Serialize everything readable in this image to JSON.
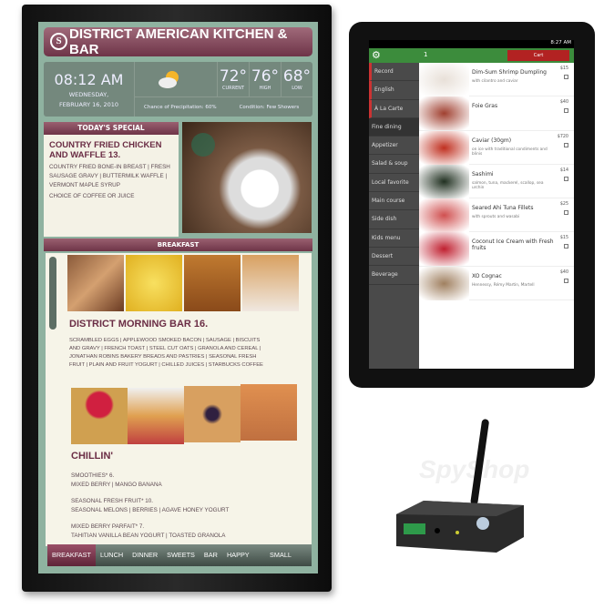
{
  "signage": {
    "title": "DISTRICT AMERICAN KITCHEN & BAR",
    "logo_letter": "S",
    "time": "08:12 AM",
    "day": "WEDNESDAY,",
    "date": "FEBRUARY 16, 2010",
    "weather_icon": "partly-cloudy-icon",
    "temps": [
      {
        "value": "72°",
        "label": "CURRENT"
      },
      {
        "value": "76°",
        "label": "HIGH"
      },
      {
        "value": "68°",
        "label": "LOW"
      }
    ],
    "precipitation": "Chance of Precipitation: 60%",
    "condition": "Condition: Few Showers",
    "special": {
      "header": "TODAY'S SPECIAL",
      "title": "COUNTRY FRIED CHICKEN AND WAFFLE 13.",
      "desc": "COUNTRY FRIED BONE-IN BREAST | FRESH SAUSAGE GRAVY | BUTTERMILK WAFFLE | VERMONT MAPLE SYRUP",
      "extra": "CHOICE OF COFFEE OR JUICE"
    },
    "section": "BREAKFAST",
    "morning": {
      "title": "DISTRICT MORNING BAR 16.",
      "desc": "SCRAMBLED EGGS | APPLEWOOD SMOKED BACON | SAUSAGE | BISCUITS AND GRAVY | FRENCH TOAST | STEEL CUT OATS | GRANOLA AND CEREAL | JONATHAN ROBINS BAKERY BREADS AND PASTRIES | SEASONAL FRESH FRUIT | PLAIN AND FRUIT YOGURT | CHILLED JUICES | STARBUCKS COFFEE"
    },
    "chillin": {
      "title": "CHILLIN'",
      "items": [
        {
          "name": "SMOOTHIES* 6.",
          "desc": "MIXED BERRY | MANGO BANANA"
        },
        {
          "name": "SEASONAL FRESH FRUIT* 10.",
          "desc": "SEASONAL MELONS | BERRIES | AGAVE HONEY YOGURT"
        },
        {
          "name": "MIXED BERRY PARFAIT* 7.",
          "desc": "TAHITIAN VANILLA BEAN YOGURT | TOASTED GRANOLA"
        }
      ]
    },
    "nav": [
      "BREAKFAST",
      "LUNCH",
      "DINNER",
      "SWEETS",
      "BAR",
      "HAPPY HOUR",
      "SMALL PLATES"
    ],
    "active_nav": "BREAKFAST",
    "colors": {
      "maroon": "#6e3448",
      "green": "#8fb2a0"
    }
  },
  "tablet": {
    "status_time": "8:27 AM",
    "table_number": "1",
    "cart_label": "Cart",
    "sidebar": [
      "Record",
      "English",
      "À La Carte",
      "Fine dining",
      "Appetizer",
      "Salad & soup",
      "Local favorite",
      "Main course",
      "Side dish",
      "Kids menu",
      "Dessert",
      "Beverage"
    ],
    "selected": "Fine dining",
    "items": [
      {
        "name": "Dim-Sum Shrimp Dumpling",
        "desc": "with cilantro and caviar",
        "price": "$15"
      },
      {
        "name": "Foie Gras",
        "desc": "",
        "price": "$40"
      },
      {
        "name": "Caviar (30gm)",
        "desc": "on ice with traditional condiments and blinis",
        "price": "$720"
      },
      {
        "name": "Sashimi",
        "desc": "salmon, tuna, mackerel, scallop, sea urchin",
        "price": "$14"
      },
      {
        "name": "Seared Ahi Tuna Fillets",
        "desc": "with sprouts and wasabi",
        "price": "$25"
      },
      {
        "name": "Coconut Ice Cream with Fresh fruits",
        "desc": "",
        "price": "$15"
      },
      {
        "name": "XO Cognac",
        "desc": "Hennessy, Rémy Martin, Martell",
        "price": "$40"
      }
    ],
    "colors": {
      "green": "#3c8c3c",
      "cart": "#b22222"
    }
  },
  "device": {
    "watermark": "SpyShop"
  }
}
